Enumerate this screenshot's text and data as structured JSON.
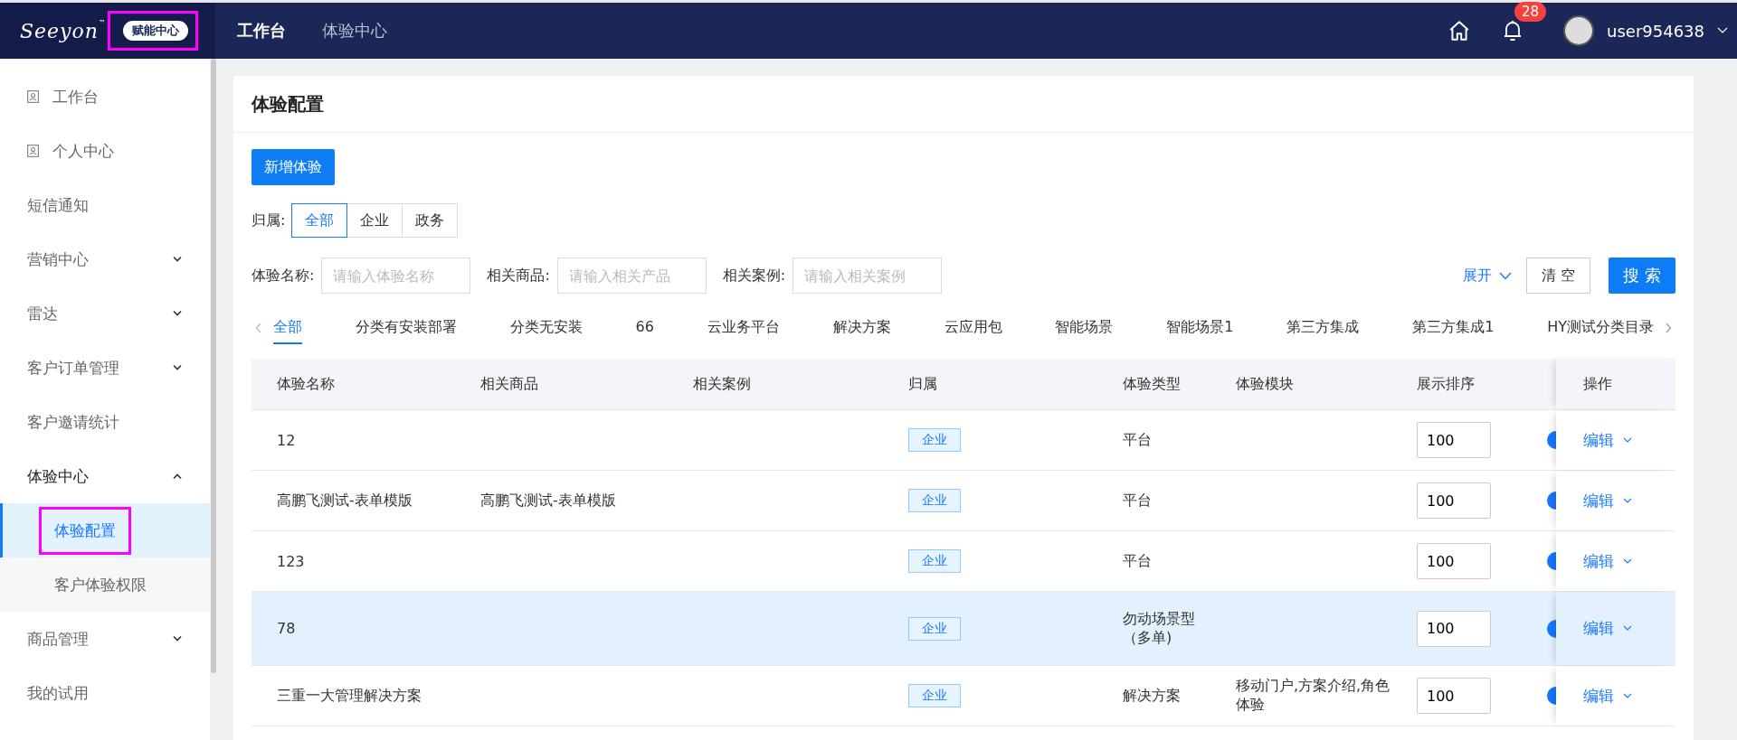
{
  "header": {
    "logo_text": "Seeyon",
    "trademark": "™",
    "badge": {
      "label": "赋能中心",
      "highlighted": true
    },
    "nav": [
      {
        "label": "工作台",
        "selected": true
      },
      {
        "label": "体验中心",
        "selected": false
      }
    ],
    "notification_count": "28",
    "username": "user954638"
  },
  "sidebar": {
    "items": [
      {
        "label": "工作台",
        "kind": "icon",
        "selected": false
      },
      {
        "label": "个人中心",
        "kind": "icon",
        "selected": false
      },
      {
        "label": "短信通知",
        "kind": "plain",
        "selected": false
      },
      {
        "label": "营销中心",
        "kind": "group",
        "expanded": false,
        "selected": false
      },
      {
        "label": "雷达",
        "kind": "group",
        "expanded": false,
        "selected": false
      },
      {
        "label": "客户订单管理",
        "kind": "group",
        "expanded": false,
        "selected": false
      },
      {
        "label": "客户邀请统计",
        "kind": "plain",
        "selected": false
      },
      {
        "label": "体验中心",
        "kind": "group",
        "expanded": true,
        "selected": false,
        "children": [
          {
            "label": "体验配置",
            "selected": true,
            "highlighted": true
          },
          {
            "label": "客户体验权限",
            "selected": false
          }
        ]
      },
      {
        "label": "商品管理",
        "kind": "group",
        "expanded": false,
        "selected": false
      },
      {
        "label": "我的试用",
        "kind": "plain",
        "selected": false
      }
    ]
  },
  "page": {
    "title": "体验配置",
    "add_button": "新增体验",
    "belong_filter": {
      "label": "归属:",
      "options": [
        {
          "label": "全部",
          "selected": true
        },
        {
          "label": "企业",
          "selected": false
        },
        {
          "label": "政务",
          "selected": false
        }
      ]
    },
    "search_fields": [
      {
        "label": "体验名称:",
        "placeholder": "请输入体验名称"
      },
      {
        "label": "相关商品:",
        "placeholder": "请输入相关产品"
      },
      {
        "label": "相关案例:",
        "placeholder": "请输入相关案例"
      }
    ],
    "expand_link": "展开",
    "clear_button": "清 空",
    "search_button": "搜 索",
    "categories": [
      {
        "label": "全部",
        "selected": true
      },
      {
        "label": "分类有安装部署",
        "selected": false
      },
      {
        "label": "分类无安装",
        "selected": false
      },
      {
        "label": "66",
        "selected": false
      },
      {
        "label": "云业务平台",
        "selected": false
      },
      {
        "label": "解决方案",
        "selected": false
      },
      {
        "label": "云应用包",
        "selected": false
      },
      {
        "label": "智能场景",
        "selected": false
      },
      {
        "label": "智能场景1",
        "selected": false
      },
      {
        "label": "第三方集成",
        "selected": false
      },
      {
        "label": "第三方集成1",
        "selected": false
      },
      {
        "label": "HY测试分类目录",
        "selected": false
      }
    ],
    "table": {
      "columns": [
        "体验名称",
        "相关商品",
        "相关案例",
        "归属",
        "体验类型",
        "体验模块",
        "展示排序",
        "操作"
      ],
      "rows": [
        {
          "name": "12",
          "goods": "",
          "case": "",
          "belong": "企业",
          "type": "平台",
          "module": "",
          "sort": "100",
          "action": "编辑",
          "selected": false
        },
        {
          "name": "高鹏飞测试-表单模版",
          "goods": "高鹏飞测试-表单模版",
          "case": "",
          "belong": "企业",
          "type": "平台",
          "module": "",
          "sort": "100",
          "action": "编辑",
          "selected": false
        },
        {
          "name": "123",
          "goods": "",
          "case": "",
          "belong": "企业",
          "type": "平台",
          "module": "",
          "sort": "100",
          "action": "编辑",
          "selected": false
        },
        {
          "name": "78",
          "goods": "",
          "case": "",
          "belong": "企业",
          "type": "勿动场景型（多单)",
          "module": "",
          "sort": "100",
          "action": "编辑",
          "selected": true
        },
        {
          "name": "三重一大管理解决方案",
          "goods": "",
          "case": "",
          "belong": "企业",
          "type": "解决方案",
          "module": "移动门户,方案介绍,角色体验",
          "sort": "100",
          "action": "编辑",
          "selected": false
        }
      ]
    }
  }
}
